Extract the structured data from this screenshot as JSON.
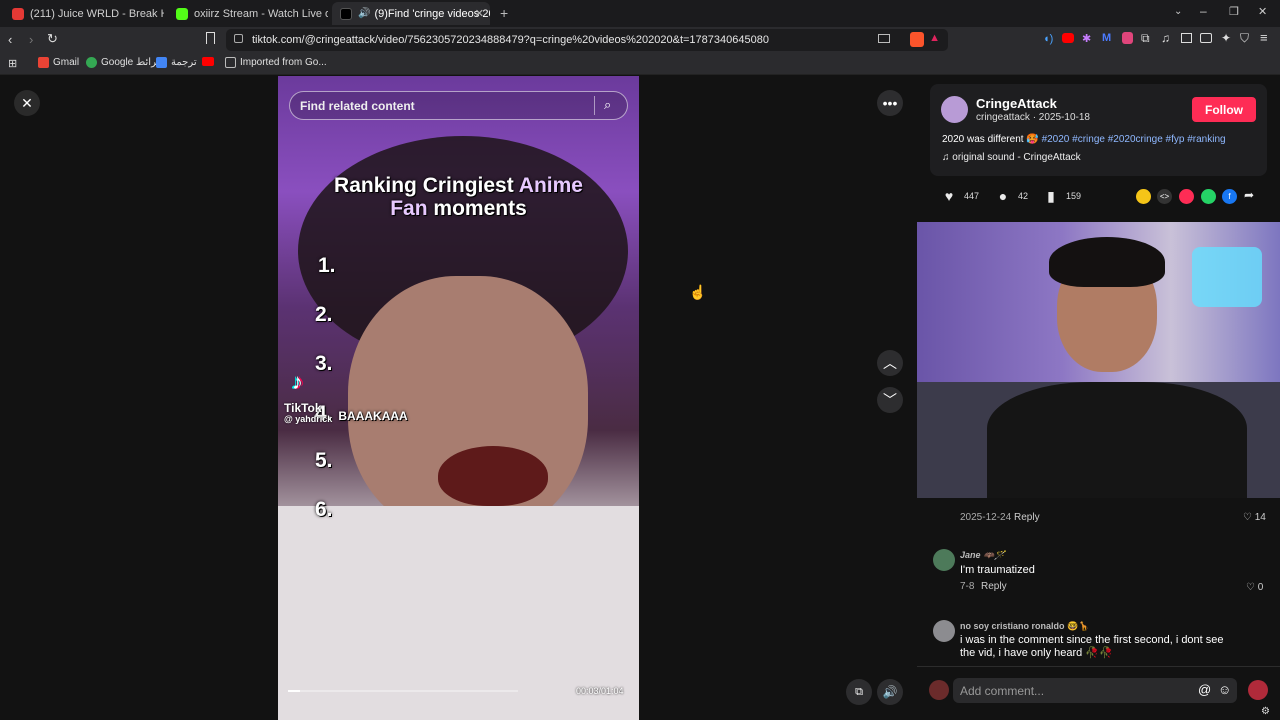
{
  "tabs": [
    {
      "title": "(211) Juice WRLD - Break Her Heart (",
      "color": "#e53935"
    },
    {
      "title": "oxiirz Stream - Watch Live on Kick",
      "color": "#53fc18"
    },
    {
      "title": "(9)Find 'cringe videos 2020' o",
      "color": "#111111"
    }
  ],
  "url": "tiktok.com/@cringeattack/video/7562305720234888479?q=cringe%20videos%202020&t=1787340645080",
  "bookmarks": [
    {
      "label": "Gmail",
      "color": "#ea4335"
    },
    {
      "label": "Google خرائط",
      "color": "#34a853"
    },
    {
      "label": "ترجمة",
      "color": "#4285f4"
    },
    {
      "label": "",
      "color": "#ff0000"
    },
    {
      "label": "Imported from Go...",
      "color": "#888888"
    }
  ],
  "video": {
    "search_placeholder": "Find related content",
    "title_line1a": "Ranking Cringiest ",
    "title_line1b": "Anime",
    "title_line2a": "Fan",
    "title_line2b": " moments",
    "rankings": [
      "1.",
      "2.",
      "3.",
      "4.",
      "5.",
      "6."
    ],
    "rank4_text": "BAAAKAAA",
    "watermark_logo": "TikTok",
    "watermark_user": "@ yahdrick",
    "time": "00:03/01:04",
    "progress": 0.05
  },
  "post": {
    "display_name": "CringeAttack",
    "username_date": "cringeattack · 2025-10-18",
    "follow_label": "Follow",
    "caption_text": "2020 was different 🥵",
    "hashtags": "#2020 #cringe #2020cringe #fyp #ranking",
    "sound": "original sound - CringeAttack",
    "likes": "447",
    "comments": "42",
    "saves": "159"
  },
  "comments": [
    {
      "date": "2025-12-24",
      "reply": "Reply",
      "likes": "14"
    },
    {
      "user": "Jane 🦇🪄",
      "text": "I'm traumatized",
      "date": "7-8",
      "reply": "Reply",
      "likes": "0"
    },
    {
      "user": "no soy cristiano ronaldo 🤓🦒",
      "text": "i was in the comment since the first second, i dont see the vid, i have only heard 🥀🥀"
    }
  ],
  "comment_input_placeholder": "Add comment..."
}
